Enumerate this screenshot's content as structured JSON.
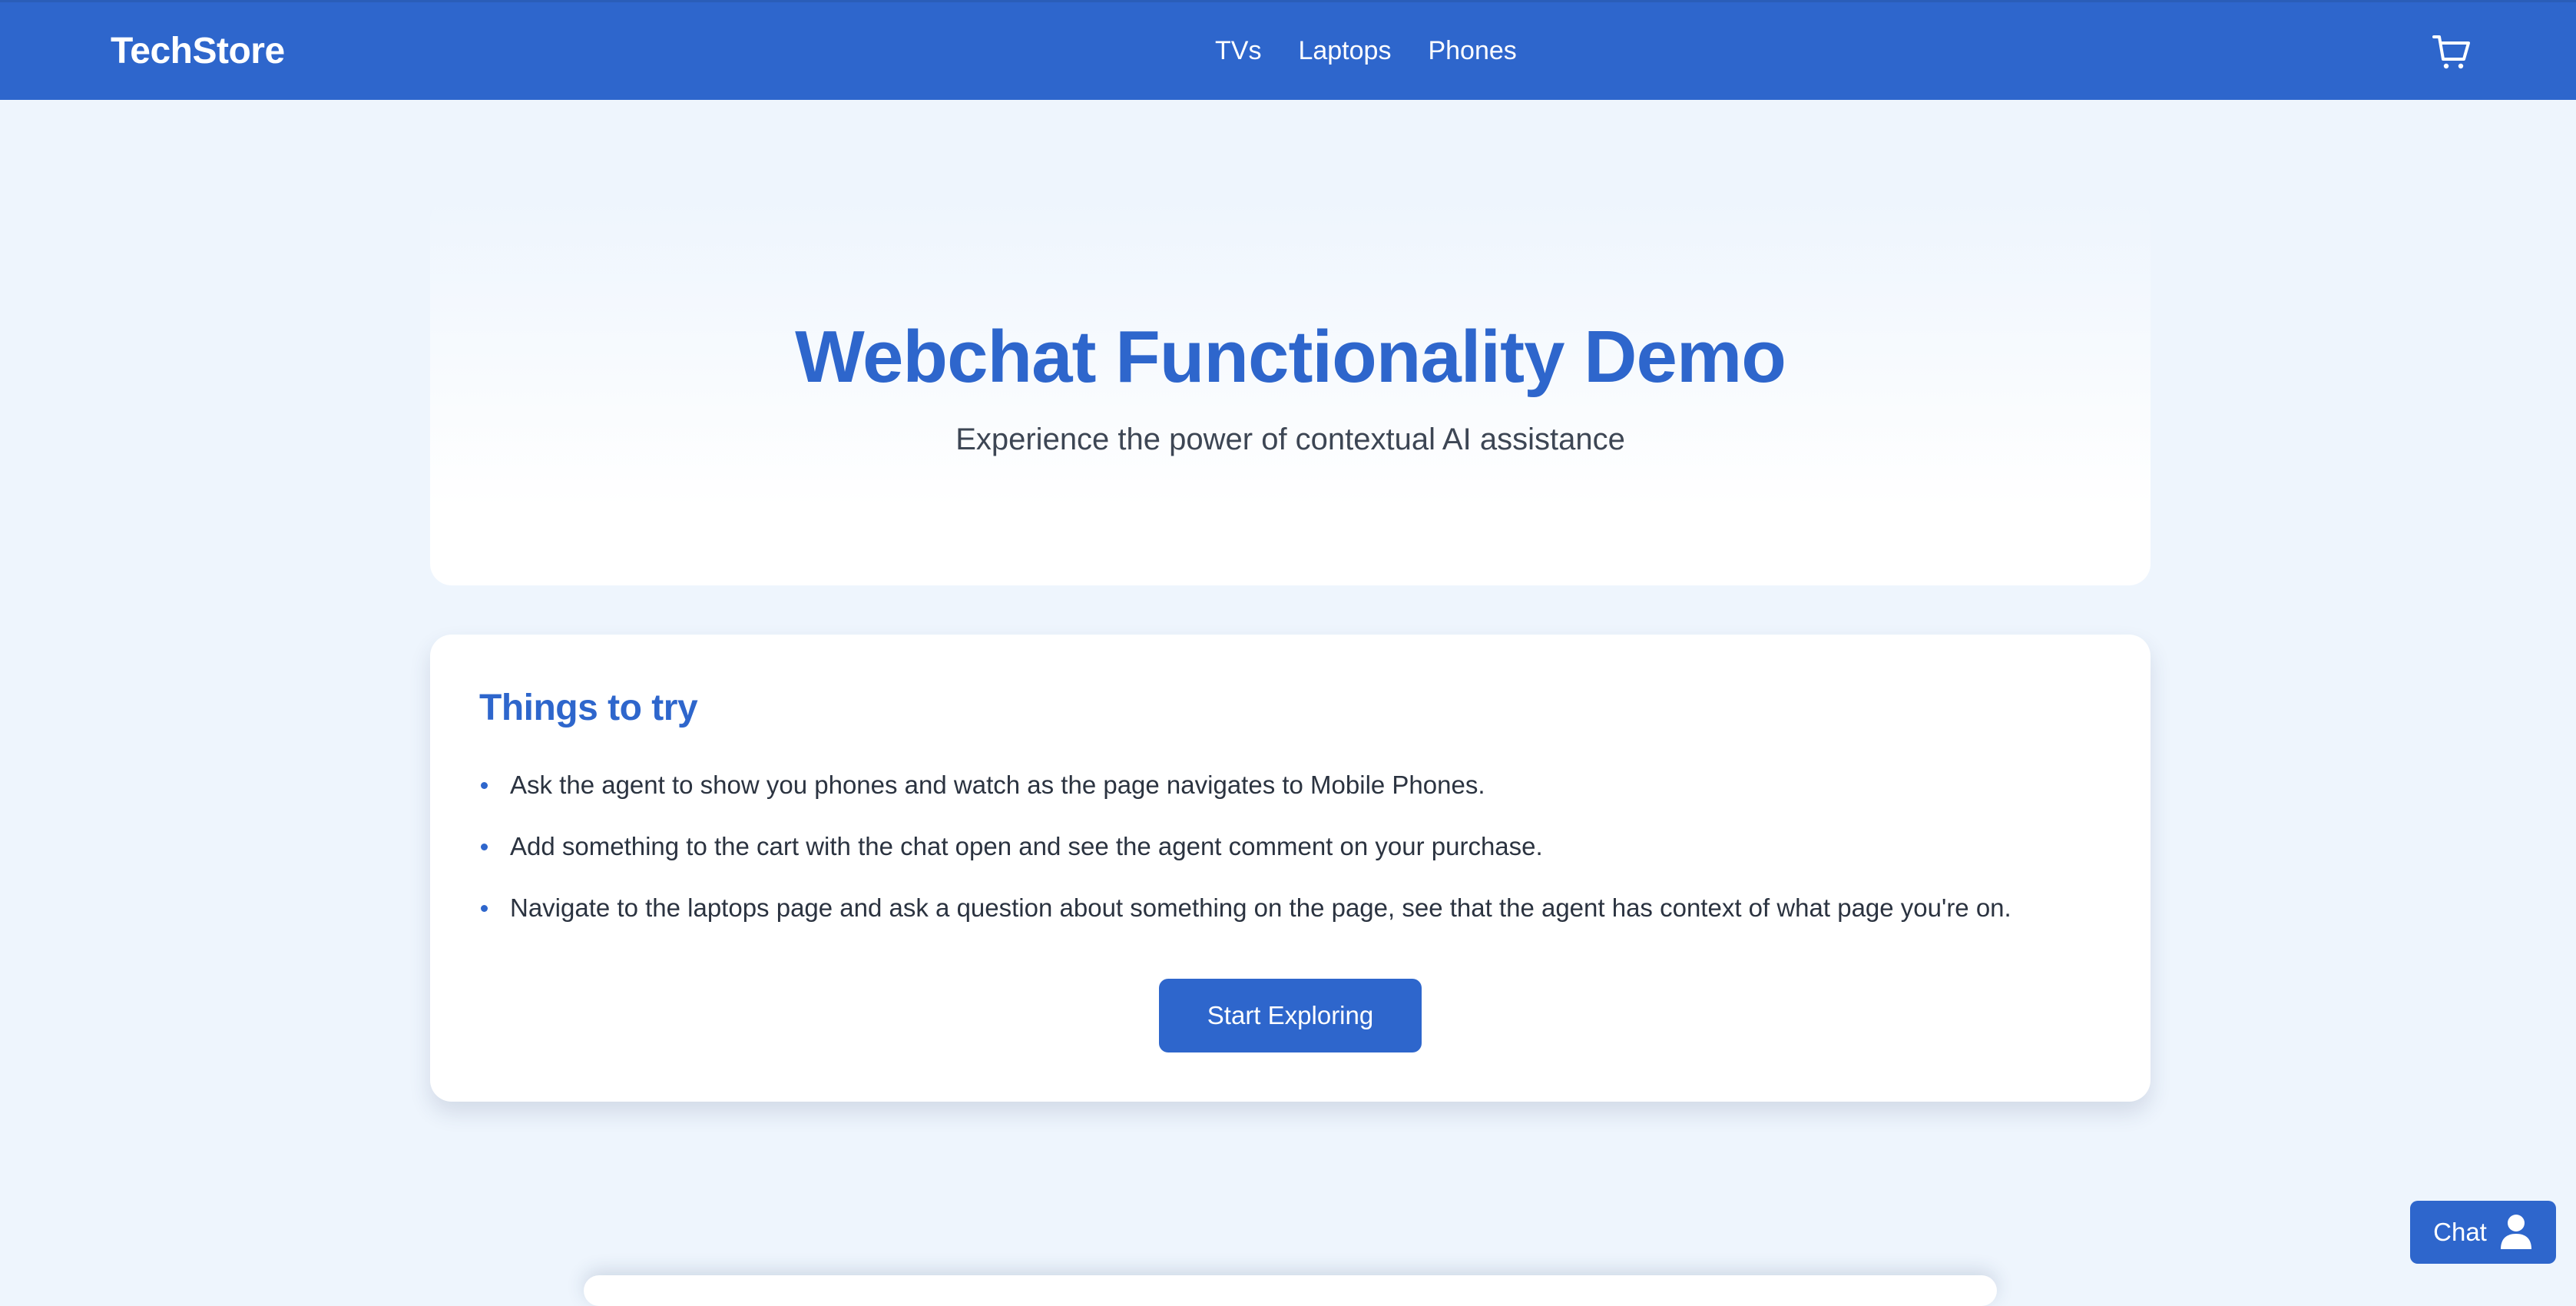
{
  "header": {
    "brand": "TechStore",
    "nav": [
      {
        "label": "TVs"
      },
      {
        "label": "Laptops"
      },
      {
        "label": "Phones"
      }
    ],
    "cart_icon": "shopping-cart-icon"
  },
  "hero": {
    "title": "Webchat Functionality Demo",
    "subtitle": "Experience the power of contextual AI assistance"
  },
  "tips": {
    "title": "Things to try",
    "items": [
      "Ask the agent to show you phones and watch as the page navigates to Mobile Phones.",
      "Add something to the cart with the chat open and see the agent comment on your purchase.",
      "Navigate to the laptops page and ask a question about something on the page, see that the agent has context of what page you're on."
    ],
    "button_label": "Start Exploring"
  },
  "chat": {
    "label": "Chat",
    "icon": "user-icon"
  },
  "colors": {
    "accent": "#2e66cc",
    "page_background": "#eef5fd",
    "text": "#2b3340"
  }
}
